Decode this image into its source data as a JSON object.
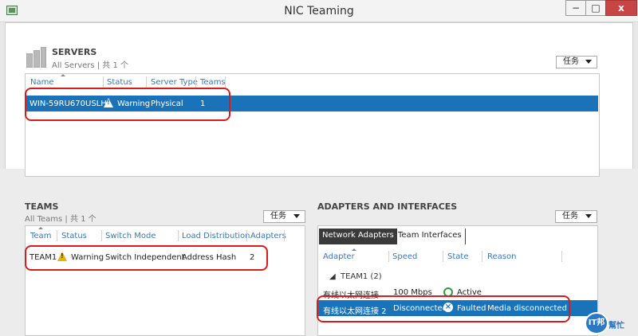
{
  "window": {
    "title": "NIC Teaming",
    "min": "−",
    "max": "□",
    "close": "x"
  },
  "servers": {
    "title": "SERVERS",
    "subtitle": "All Servers | 共 1 个",
    "tasks": "任务",
    "columns": [
      "Name",
      "Status",
      "Server Type",
      "Teams"
    ],
    "rows": [
      {
        "name": "WIN-59RU670USLH",
        "status": "Warning",
        "type": "Physical",
        "teams": "1"
      }
    ]
  },
  "teams": {
    "title": "TEAMS",
    "subtitle": "All Teams | 共 1 个",
    "tasks": "任务",
    "columns": [
      "Team",
      "Status",
      "Switch Mode",
      "Load Distribution",
      "Adapters"
    ],
    "rows": [
      {
        "team": "TEAM1",
        "status": "Warning",
        "mode": "Switch Independent",
        "load": "Address Hash",
        "adapters": "2"
      }
    ]
  },
  "adapters": {
    "title": "ADAPTERS AND INTERFACES",
    "tasks": "任务",
    "tabs": [
      "Network Adapters",
      "Team Interfaces"
    ],
    "columns": [
      "Adapter",
      "Speed",
      "State",
      "Reason"
    ],
    "group": "TEAM1 (2)",
    "rows": [
      {
        "adapter": "有线以太网连接",
        "speed": "100 Mbps",
        "state": "Active",
        "reason": ""
      },
      {
        "adapter": "有线以太网连接 2",
        "speed": "Disconnected",
        "state": "Faulted",
        "reason": "Media disconnected"
      }
    ]
  },
  "watermark": {
    "logo": "IT邦",
    "text": "幫忙"
  },
  "colors": {
    "selection": "#1a73b8",
    "highlight": "#d41e1e",
    "header_text": "#3a78b5"
  },
  "icons": {
    "warning": "warning-triangle-icon",
    "active": "green-check-icon",
    "faulted": "fault-x-icon"
  }
}
